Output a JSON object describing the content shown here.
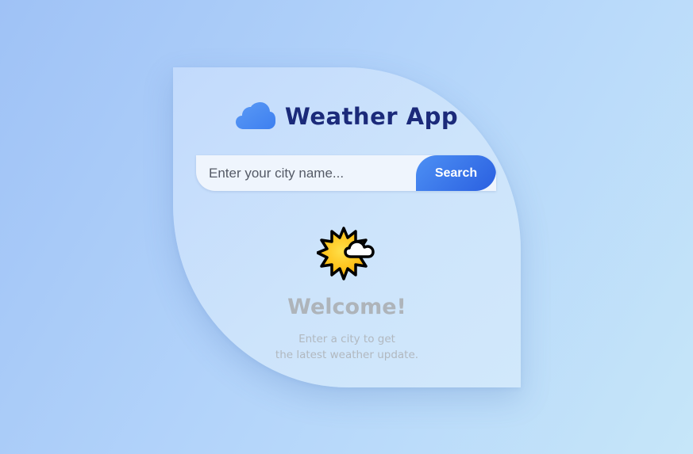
{
  "app": {
    "title": "Weather App",
    "title_icon": "cloud-icon"
  },
  "search": {
    "placeholder": "Enter your city name...",
    "value": "",
    "button_label": "Search"
  },
  "welcome": {
    "icon": "sun-behind-cloud-icon",
    "heading": "Welcome!",
    "line1": "Enter a city to get",
    "line2": "the latest weather update."
  },
  "colors": {
    "title": "#1b2a7a",
    "accent": "#3a73ea",
    "muted_text": "#aeb4ba"
  }
}
